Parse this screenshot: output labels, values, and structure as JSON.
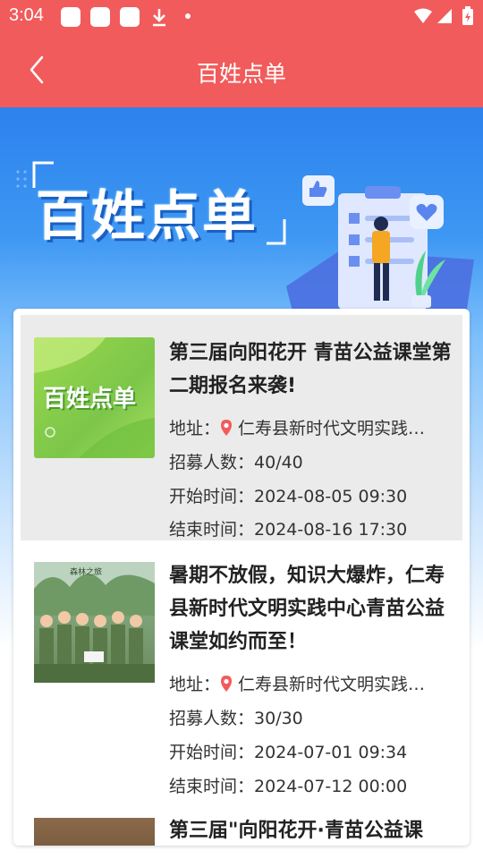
{
  "status_bar": {
    "time": "3:04"
  },
  "app_bar": {
    "title": "百姓点单"
  },
  "banner": {
    "title": "百姓点单"
  },
  "items": [
    {
      "title": "第三届向阳花开  青苗公益课堂第二期报名来袭!",
      "thumb_text": "百姓点单",
      "address_label": "地址：",
      "address": "仁寿县新时代文明实践中心",
      "recruit_label": "招募人数：",
      "recruit": "40/40",
      "start_label": "开始时间：",
      "start": "2024-08-05 09:30",
      "end_label": "结束时间：",
      "end": "2024-08-16 17:30"
    },
    {
      "title": "暑期不放假，知识大爆炸，仁寿县新时代文明实践中心青苗公益课堂如约而至！",
      "address_label": "地址：",
      "address": "仁寿县新时代文明实践中心",
      "recruit_label": "招募人数：",
      "recruit": "30/30",
      "start_label": "开始时间：",
      "start": "2024-07-01 09:34",
      "end_label": "结束时间：",
      "end": "2024-07-12 00:00"
    },
    {
      "title": "第三届\"向阳花开·青苗公益课"
    }
  ],
  "colors": {
    "primary": "#f25b5b",
    "banner_blue": "#2d82ec",
    "pin_red": "#f25b5b"
  }
}
